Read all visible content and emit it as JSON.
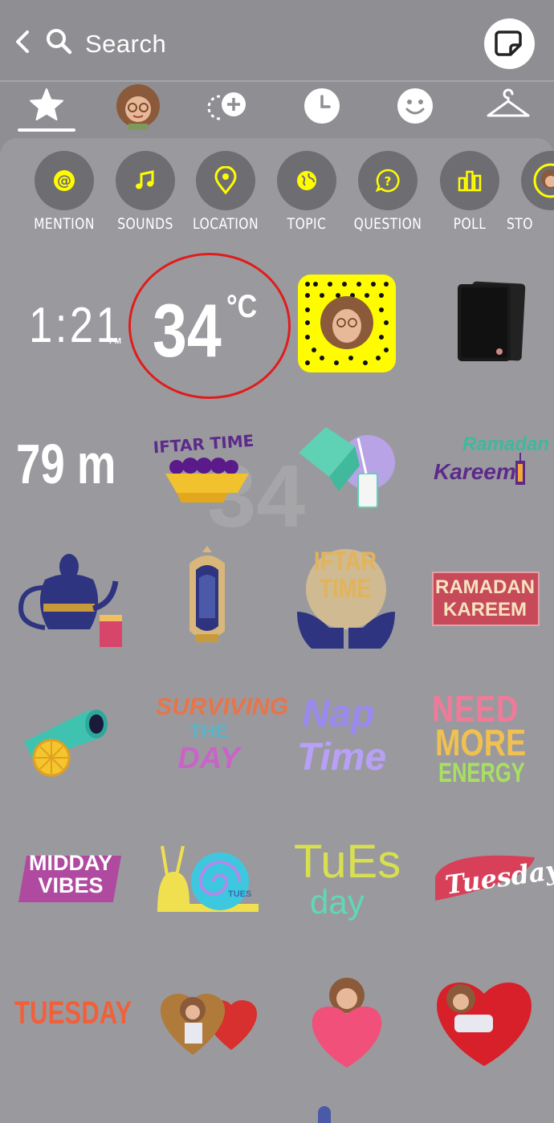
{
  "header": {
    "search_placeholder": "Search"
  },
  "categories": [
    {
      "label": "MENTION",
      "icon": "at-icon"
    },
    {
      "label": "SOUNDS",
      "icon": "music-note-icon"
    },
    {
      "label": "LOCATION",
      "icon": "location-pin-icon"
    },
    {
      "label": "TOPIC",
      "icon": "globe-icon"
    },
    {
      "label": "QUESTION",
      "icon": "question-bubble-icon"
    },
    {
      "label": "POLL",
      "icon": "bar-poll-icon"
    },
    {
      "label": "STO",
      "icon": "story-icon"
    }
  ],
  "stickers": {
    "time": {
      "value": "1:21",
      "suffix": "PM"
    },
    "temperature": {
      "value": "34",
      "unit": "°C"
    },
    "altitude": {
      "value": "79 m"
    },
    "iftar_time_text": "IFTAR TIME",
    "ramadan_kareem_script": "Ramadan",
    "ramadan_kareem_script2": "Kareem",
    "iftar_time_block": "IFTAR TIME",
    "ramadan_kareem_block_1": "RAMADAN",
    "ramadan_kareem_block_2": "KAREEM",
    "surviving_1": "SURVIVING",
    "surviving_2": "THE",
    "surviving_3": "DAY",
    "nap_1": "Nap",
    "nap_2": "Time",
    "need_1": "NEED",
    "need_2": "MORE",
    "need_3": "ENERGY",
    "midday_1": "MIDDAY",
    "midday_2": "VIBES",
    "tues_1": "TuEs",
    "tues_2": "day",
    "tuesday_script": "Tuesday",
    "tuesday_block": "TUESDAY",
    "snail_label": "TUES"
  },
  "watermark": "34",
  "colors": {
    "accent": "#fffc00",
    "highlight": "#e11c1c",
    "background": "#9a9a9e"
  }
}
